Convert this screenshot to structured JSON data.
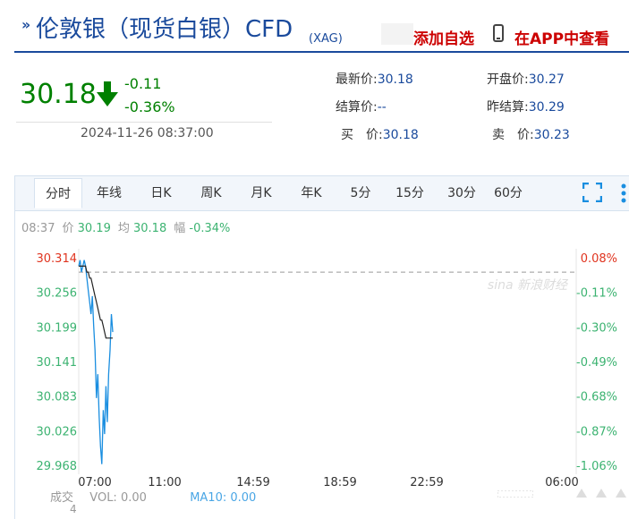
{
  "header": {
    "title": "伦敦银（现货白银）CFD",
    "symbol": "(XAG)",
    "add_watchlist": "添加自选",
    "app_check": "在APP中查看"
  },
  "quote": {
    "price": "30.18",
    "change": "-0.11",
    "change_pct": "-0.36%",
    "timestamp": "2024-11-26 08:37:00",
    "latest_label": "最新价:",
    "latest": "30.18",
    "open_label": "开盘价:",
    "open": "30.27",
    "settle_label": "结算价:",
    "settle": "--",
    "prev_settle_label": "昨结算:",
    "prev_settle": "30.29",
    "buy_label": "买　价:",
    "buy": "30.18",
    "sell_label": "卖　价:",
    "sell": "30.23"
  },
  "tabs": [
    "分时",
    "年线",
    "日K",
    "周K",
    "月K",
    "年K",
    "5分",
    "15分",
    "30分",
    "60分"
  ],
  "active_tab": "分时",
  "info_bar": {
    "time": "08:37",
    "price_label": "价",
    "price": "30.19",
    "avg_label": "均",
    "avg": "30.18",
    "amp_label": "幅",
    "amp": "-0.34%"
  },
  "watermark": "sina 新浪财经",
  "volume": {
    "label": "成交",
    "label_count": "4",
    "vol_text": "VOL: 0.00",
    "ma10_text": "MA10: 0.00"
  },
  "colors": {
    "up": "#e0341f",
    "down": "#008000",
    "price_line": "#1a8ee0",
    "avg_line": "#222222",
    "ref_line": "#999999",
    "brand": "#1a4a9c",
    "red": "#cc0000"
  },
  "chart_data": {
    "type": "line",
    "y_ticks": [
      "30.314",
      "30.256",
      "30.199",
      "30.141",
      "30.083",
      "30.026",
      "29.968"
    ],
    "y_pct_ticks": [
      "0.08%",
      "-0.11%",
      "-0.30%",
      "-0.49%",
      "-0.68%",
      "-0.87%",
      "-1.06%"
    ],
    "x_ticks": [
      "07:00",
      "11:00",
      "14:59",
      "18:59",
      "22:59",
      "06:00"
    ],
    "ylim": [
      29.968,
      30.314
    ],
    "reference": 30.29,
    "series": [
      {
        "values": [
          30.3,
          30.31,
          30.29,
          30.3,
          30.31,
          30.3,
          30.28,
          30.26,
          30.24,
          30.22,
          30.25,
          30.2,
          30.16,
          30.08,
          30.12,
          30.05,
          30.0,
          29.97,
          30.06,
          30.02,
          30.1,
          30.04,
          30.12,
          30.16,
          30.22,
          30.19
        ]
      },
      {
        "values": [
          30.3,
          30.3,
          30.3,
          30.3,
          30.3,
          30.3,
          30.29,
          30.29,
          30.28,
          30.28,
          30.27,
          30.26,
          30.25,
          30.24,
          30.23,
          30.22,
          30.21,
          30.21,
          30.2,
          30.19,
          30.18,
          30.18,
          30.18,
          30.18,
          30.18,
          30.18
        ]
      }
    ]
  }
}
